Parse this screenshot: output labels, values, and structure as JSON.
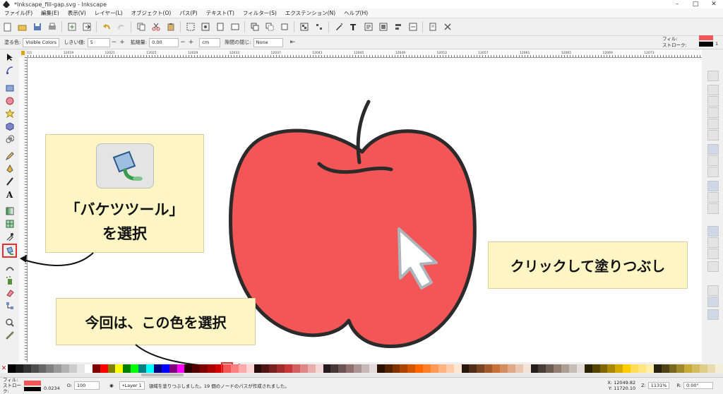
{
  "window": {
    "title": "*Inkscape_fill-gap.svg - Inkscape"
  },
  "menu": [
    "ファイル(F)",
    "編集(E)",
    "表示(V)",
    "レイヤー(L)",
    "オブジェクト(O)",
    "パス(P)",
    "テキスト(T)",
    "フィルター(S)",
    "エクステンション(N)",
    "ヘルプ(H)"
  ],
  "controls": {
    "fill_by_label": "塗る色:",
    "fill_by_value": "Visible Colors",
    "threshold_label": "しきい値:",
    "threshold_value": "5",
    "grow_label": "拡縮量:",
    "grow_value": "0.00",
    "unit": "cm",
    "close_gaps_label": "隙間の閉じ:",
    "close_gaps_value": "None"
  },
  "style_indicator": {
    "fill_label": "フィル:",
    "stroke_label": "ストローク:",
    "stroke_width": "1"
  },
  "ruler": [
    "12011",
    "12019",
    "12021",
    "12025",
    "12029",
    "12033",
    "12037",
    "12041",
    "12045",
    "12049",
    "12053",
    "12057",
    "12061",
    "12065",
    "12069",
    "12073"
  ],
  "callouts": {
    "bucket_title": "「バケツツール」",
    "bucket_sub": "を選択",
    "click_fill": "クリックして塗りつぶし",
    "pick_color": "今回は、この色を選択"
  },
  "status": {
    "fill_label": "フィル:",
    "stroke_label": "ストローク:",
    "stroke_width": "0.0234",
    "opacity_label": "O:",
    "opacity_value": "100",
    "layer": "•Layer 1",
    "message": "領域を塗りつぶしました。19 個のノードのパスが作成されました。",
    "x_label": "X:",
    "x_value": "12049.82",
    "y_label": "Y:",
    "y_value": "11720.10",
    "zoom_label": "Z:",
    "zoom_value": "1131%",
    "rotate_label": "R:",
    "rotate_value": "0.00°"
  },
  "colors": {
    "apple": "#f25656",
    "outline": "#2b2b2b",
    "callout": "#fdf6c4",
    "highlight": "#e53030"
  }
}
